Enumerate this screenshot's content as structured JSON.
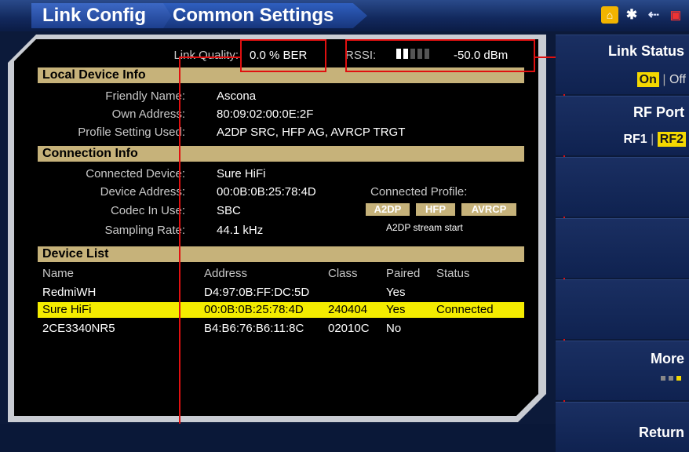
{
  "breadcrumb": {
    "level1": "Link Config",
    "level2": "Common Settings"
  },
  "status_icons": [
    "home-icon",
    "bluetooth-icon",
    "usb-icon",
    "dock-icon"
  ],
  "link": {
    "quality_label": "Link Quality:",
    "quality_value": "0.0 % BER",
    "rssi_label": "RSSI:",
    "rssi_value": "-50.0 dBm",
    "rssi_level_fraction": 0.4
  },
  "local": {
    "header": "Local Device Info",
    "friendly_label": "Friendly Name:",
    "friendly_value": "Ascona",
    "own_label": "Own Address:",
    "own_value": "80:09:02:00:0E:2F",
    "profile_label": "Profile Setting Used:",
    "profile_value": "A2DP SRC, HFP AG, AVRCP TRGT"
  },
  "connection": {
    "header": "Connection Info",
    "device_label": "Connected Device:",
    "device_value": "Sure HiFi",
    "address_label": "Device Address:",
    "address_value": "00:0B:0B:25:78:4D",
    "codec_label": "Codec In Use:",
    "codec_value": "SBC",
    "rate_label": "Sampling Rate:",
    "rate_value": "44.1 kHz",
    "profile_title": "Connected Profile:",
    "profiles": [
      "A2DP",
      "HFP",
      "AVRCP"
    ],
    "stream_status": "A2DP stream start"
  },
  "device_list": {
    "header": "Device List",
    "columns": [
      "Name",
      "Address",
      "Class",
      "Paired",
      "Status"
    ],
    "rows": [
      [
        "RedmiWH",
        "D4:97:0B:FF:DC:5D",
        "",
        "Yes",
        ""
      ],
      [
        "Sure HiFi",
        "00:0B:0B:25:78:4D",
        "240404",
        "Yes",
        "Connected"
      ],
      [
        "2CE3340NR5",
        "B4:B6:76:B6:11:8C",
        "02010C",
        "No",
        ""
      ]
    ]
  },
  "softkeys": {
    "link_status": {
      "title": "Link Status",
      "on": "On",
      "sep": "|",
      "off": "Off"
    },
    "rf_port": {
      "title": "RF Port",
      "rf1": "RF1",
      "sep": "|",
      "rf2": "RF2"
    },
    "more": "More",
    "return": "Return"
  },
  "colors": {
    "highlight": "#f4ec00",
    "section_header": "#c6b27a",
    "annotation": "#e01010",
    "accent": "#f4d800"
  }
}
